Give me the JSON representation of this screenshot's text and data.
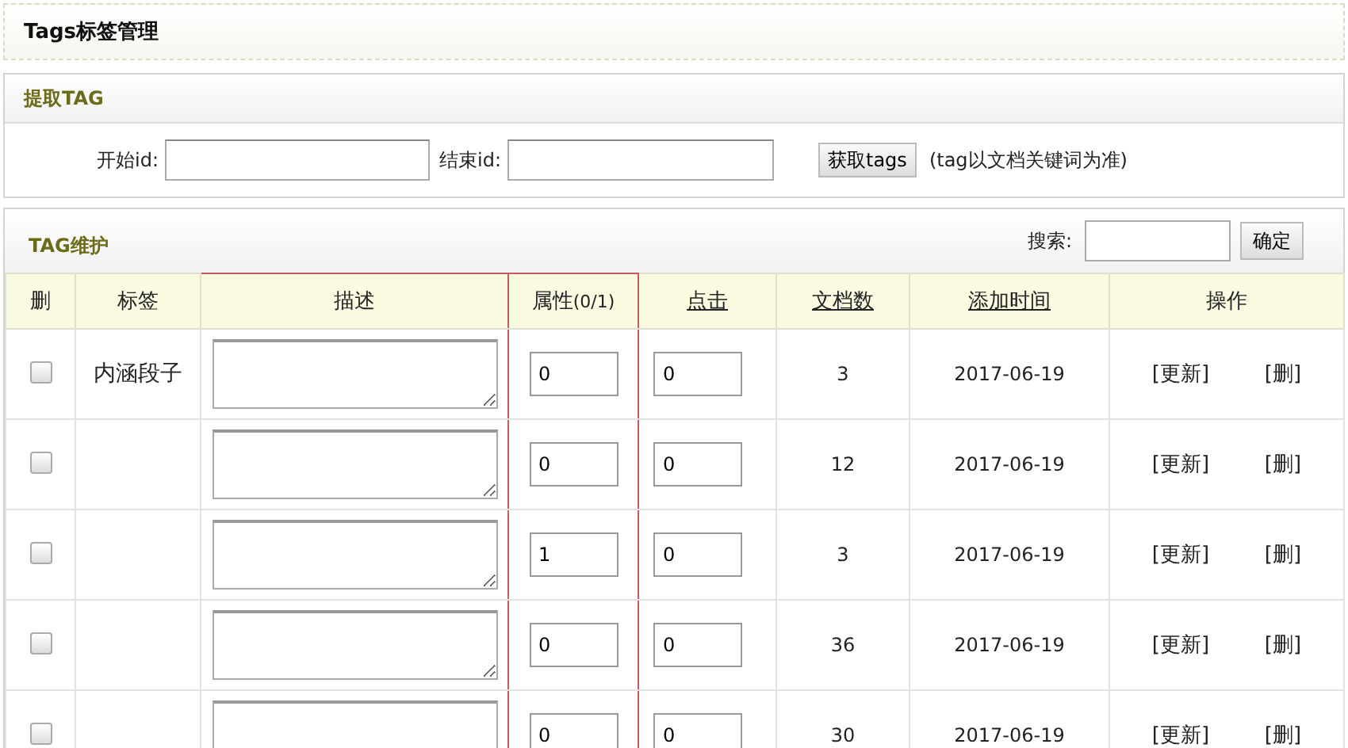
{
  "page_title": "Tags标签管理",
  "extract": {
    "title": "提取TAG",
    "start_label": "开始id:",
    "end_label": "结束id:",
    "button": "获取tags",
    "note": "(tag以文档关键词为准)"
  },
  "maintain": {
    "title": "TAG维护",
    "search_label": "搜索:",
    "search_button": "确定"
  },
  "table": {
    "columns": [
      {
        "label": "删",
        "sortable": false,
        "highlighted": false
      },
      {
        "label": "标签",
        "sortable": false,
        "highlighted": false
      },
      {
        "label": "描述",
        "sortable": false,
        "highlighted": true
      },
      {
        "label": "属性",
        "suffix": "(0/1)",
        "sortable": false,
        "highlighted": true
      },
      {
        "label": "点击",
        "sortable": true,
        "highlighted": false
      },
      {
        "label": "文档数",
        "sortable": true,
        "highlighted": false
      },
      {
        "label": "添加时间",
        "sortable": true,
        "highlighted": false
      },
      {
        "label": "操作",
        "sortable": false,
        "highlighted": false
      }
    ],
    "rows": [
      {
        "checked": false,
        "tag": "内涵段子",
        "attribute": "0",
        "clicks": "0",
        "documents": "3",
        "date": "2017-06-19",
        "actions": [
          "[更新]",
          "[删]"
        ]
      },
      {
        "checked": false,
        "attribute": "0",
        "clicks": "0",
        "documents": "12",
        "date": "2017-06-19",
        "actions": [
          "[更新]",
          "[删]"
        ]
      },
      {
        "checked": false,
        "attribute": "1",
        "clicks": "0",
        "documents": "3",
        "date": "2017-06-19",
        "actions": [
          "[更新]",
          "[删]"
        ]
      },
      {
        "checked": false,
        "attribute": "0",
        "clicks": "0",
        "documents": "36",
        "date": "2017-06-19",
        "actions": [
          "[更新]",
          "[删]"
        ]
      },
      {
        "checked": false,
        "attribute": "0",
        "clicks": "0",
        "documents": "30",
        "date": "2017-06-19",
        "actions": [
          "[更新]",
          "[删]"
        ]
      }
    ]
  }
}
